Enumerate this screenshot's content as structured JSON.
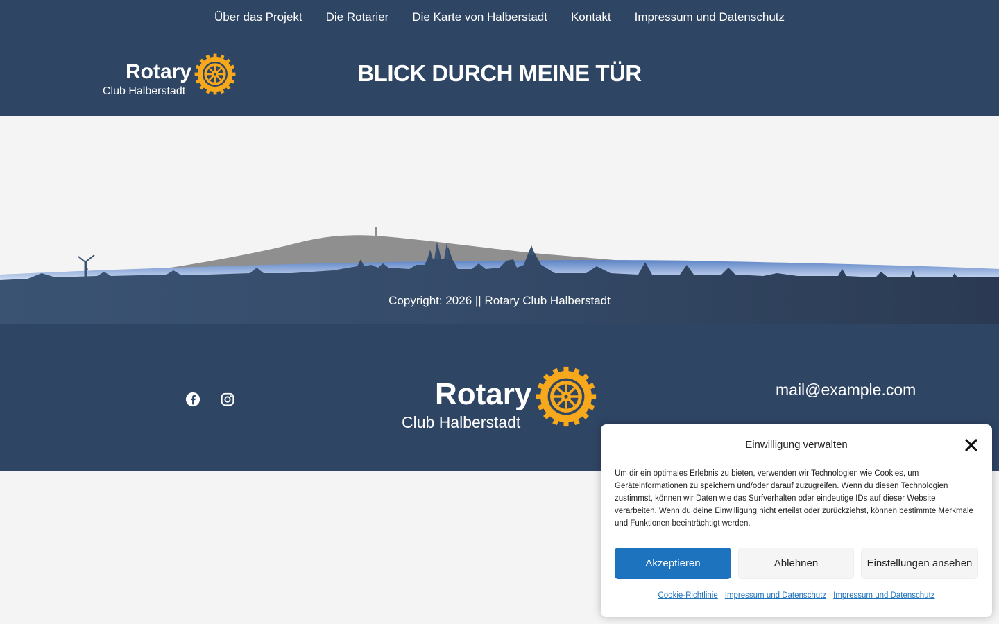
{
  "nav": {
    "items": [
      {
        "label": "Über das Projekt"
      },
      {
        "label": "Die Rotarier"
      },
      {
        "label": "Die Karte von Halberstadt"
      },
      {
        "label": "Kontakt"
      },
      {
        "label": "Impressum und Datenschutz"
      }
    ]
  },
  "header": {
    "logo_word": "Rotary",
    "logo_sub": "Club Halberstadt",
    "title": "BLICK DURCH MEINE TÜR"
  },
  "skyline": {
    "copyright": "Copyright: 2026 || Rotary Club Halberstadt"
  },
  "footer": {
    "social": [
      {
        "icon": "facebook-icon"
      },
      {
        "icon": "instagram-icon"
      }
    ],
    "logo_word": "Rotary",
    "logo_sub": "Club Halberstadt",
    "email": "mail@example.com"
  },
  "consent": {
    "title": "Einwilligung verwalten",
    "text": "Um dir ein optimales Erlebnis zu bieten, verwenden wir Technologien wie Cookies, um Geräteinformationen zu speichern und/oder darauf zuzugreifen. Wenn du diesen Technologien zustimmst, können wir Daten wie das Surfverhalten oder eindeutige IDs auf dieser Website verarbeiten. Wenn du deine Einwilligung nicht erteilst oder zurückziehst, können bestimmte Merkmale und Funktionen beeinträchtigt werden.",
    "accept_label": "Akzeptieren",
    "deny_label": "Ablehnen",
    "prefs_label": "Einstellungen ansehen",
    "links": [
      {
        "label": "Cookie-Richtlinie"
      },
      {
        "label": "Impressum und Datenschutz"
      },
      {
        "label": "Impressum und Datenschutz"
      }
    ]
  },
  "colors": {
    "brand_navy": "#2f4564",
    "rotary_gold": "#f7a81b",
    "accept_blue": "#1e73be"
  }
}
